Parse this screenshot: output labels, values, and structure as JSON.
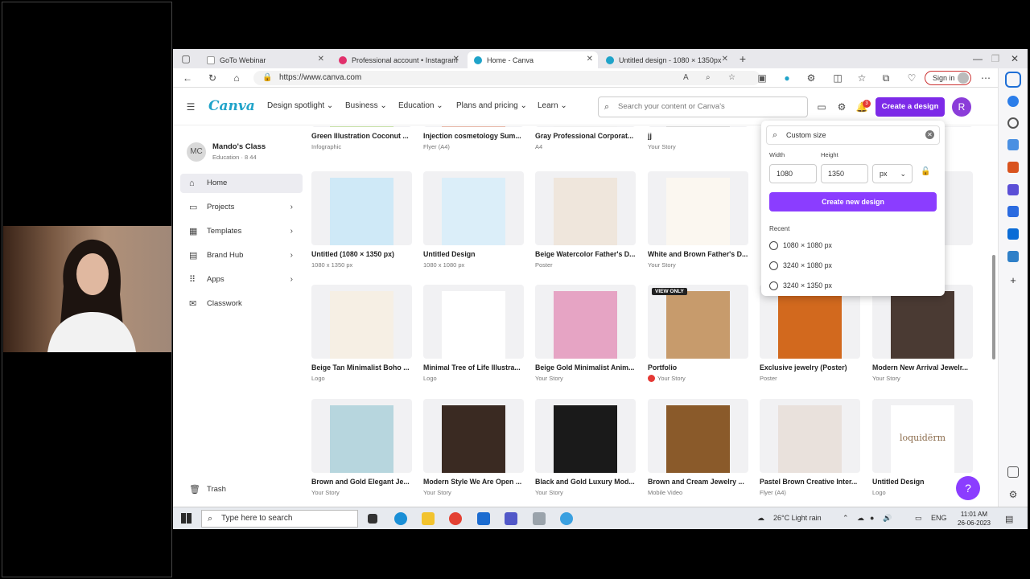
{
  "tabs": [
    {
      "label": "GoTo Webinar",
      "color": "#ffffff"
    },
    {
      "label": "Professional account • Instagram",
      "color": "#e1306c"
    },
    {
      "label": "Home - Canva",
      "color": "#1fa3c9"
    },
    {
      "label": "Untitled design - 1080 × 1350px",
      "color": "#1fa3c9"
    }
  ],
  "address": {
    "url": "https://www.canva.com"
  },
  "browser": {
    "signin_label": "Sign in"
  },
  "header": {
    "logo": "Canva",
    "nav": [
      "Design spotlight",
      "Business",
      "Education",
      "Plans and pricing",
      "Learn"
    ],
    "search_placeholder": "Search your content or Canva's",
    "notifications": "3",
    "create_label": "Create a design",
    "avatar_initial": "R"
  },
  "sidebar": {
    "avatar": "MC",
    "team_name": "Mando's Class",
    "team_meta": "Education · 8 44",
    "items": [
      {
        "label": "Home",
        "icon": "home-icon"
      },
      {
        "label": "Projects",
        "icon": "folder-icon"
      },
      {
        "label": "Templates",
        "icon": "templates-icon"
      },
      {
        "label": "Brand Hub",
        "icon": "brand-icon"
      },
      {
        "label": "Apps",
        "icon": "apps-icon"
      },
      {
        "label": "Classwork",
        "icon": "classwork-icon"
      }
    ],
    "trash": "Trash"
  },
  "grid": {
    "row0": [
      {
        "title": "Green Illustration Coconut ...",
        "sub": "Infographic"
      },
      {
        "title": "Injection cosmetology Sum...",
        "sub": "Flyer (A4)"
      },
      {
        "title": "Gray Professional Corporat...",
        "sub": "A4"
      },
      {
        "title": "jj",
        "sub": "Your Story"
      },
      {
        "title": "",
        "sub": ""
      },
      {
        "title": "...siness ...",
        "sub": ""
      }
    ],
    "row1": [
      {
        "title": "Untitled (1080 × 1350 px)",
        "sub": "1080 x 1350 px",
        "color": "#cfe9f7"
      },
      {
        "title": "Untitled Design",
        "sub": "1080 x 1080 px",
        "color": "#dbeef9"
      },
      {
        "title": "Beige Watercolor Father's D...",
        "sub": "Poster",
        "color": "#efe6dc"
      },
      {
        "title": "White and Brown Father's D...",
        "sub": "Your Story",
        "color": "#fbf7f0"
      },
      {
        "title": "",
        "sub": "",
        "color": "#f1f1f3"
      },
      {
        "title": "...dio Log...",
        "sub": "",
        "color": "#f1f1f3"
      }
    ],
    "row2": [
      {
        "title": "Beige Tan Minimalist Boho ...",
        "sub": "Logo",
        "color": "#f6efe4"
      },
      {
        "title": "Minimal Tree of Life Illustra...",
        "sub": "Logo",
        "color": "#ffffff"
      },
      {
        "title": "Beige Gold Minimalist Anim...",
        "sub": "Your Story",
        "color": "#e6a4c4"
      },
      {
        "title": "Portfolio",
        "sub": "Your Story",
        "color": "#c79b6c",
        "badge": "VIEW ONLY"
      },
      {
        "title": "Exclusive jewelry (Poster)",
        "sub": "Poster",
        "color": "#d2691e"
      },
      {
        "title": "Modern New Arrival Jewelr...",
        "sub": "Your Story",
        "color": "#4a3a33"
      }
    ],
    "row3": [
      {
        "title": "Brown and Gold Elegant Je...",
        "sub": "Your Story",
        "color": "#b7d6de"
      },
      {
        "title": "Modern Style We Are Open ...",
        "sub": "Your Story",
        "color": "#3a2a22"
      },
      {
        "title": "Black and Gold Luxury Mod...",
        "sub": "Your Story",
        "color": "#1a1a1a"
      },
      {
        "title": "Brown and Cream Jewelry ...",
        "sub": "Mobile Video",
        "color": "#8a5a2a"
      },
      {
        "title": "Pastel Brown Creative Inter...",
        "sub": "Flyer (A4)",
        "color": "#e9e1dc"
      },
      {
        "title": "Untitled Design",
        "sub": "Logo",
        "color": "#ffffff",
        "text": "loquidërm"
      }
    ]
  },
  "popup": {
    "search_value": "Custom size",
    "width_label": "Width",
    "height_label": "Height",
    "width_value": "1080",
    "height_value": "1350",
    "unit": "px",
    "create_label": "Create new design",
    "recent_label": "Recent",
    "recent": [
      "1080 × 1080 px",
      "3240 × 1080 px",
      "3240 × 1350 px"
    ]
  },
  "taskbar": {
    "search_placeholder": "Type here to search",
    "weather": "26°C  Light rain",
    "lang": "ENG",
    "time": "11:01 AM",
    "date": "26-06-2023"
  },
  "help_label": "?"
}
